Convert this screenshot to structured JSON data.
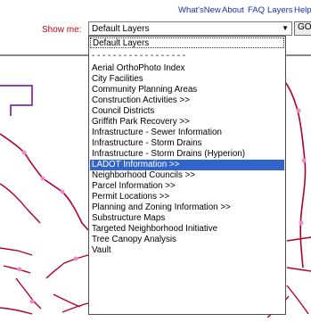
{
  "header": {
    "nav_links": [
      "What'sNew",
      "About",
      "FAQ",
      "Layers",
      "Help"
    ]
  },
  "toolbar": {
    "show_me_label": "Show me:",
    "selected_value": "Default Layers",
    "go_label": "GO"
  },
  "dropdown": {
    "options": [
      "Default Layers",
      "- - - - - - - - - - - - - - - - - -",
      "Aerial OrthoPhoto Index",
      "City Facilities",
      "Community Planning Areas",
      "Construction Activities >>",
      "Council Districts",
      "Griffith Park Recovery >>",
      "Infrastructure - Sewer Information",
      "Infrastructure - Storm Drains",
      "Infrastructure - Storm Drains (Hyperion)",
      "LADOT Information >>",
      "Neighborhood Councils >>",
      "Parcel Information >>",
      "Permit Locations >>",
      "Planning and Zoning Information >>",
      "Substructure Maps",
      "Targeted Neighborhood Initiative",
      "Tree Canopy Analysis",
      "Vault"
    ],
    "highlighted_index": 11
  },
  "colors": {
    "link": "#1a2fb0",
    "label": "#c2001a",
    "highlight": "#3165cc",
    "map_line": "#b0002a",
    "map_node": "#f08ad0",
    "map_purple": "#6a0aa0"
  }
}
